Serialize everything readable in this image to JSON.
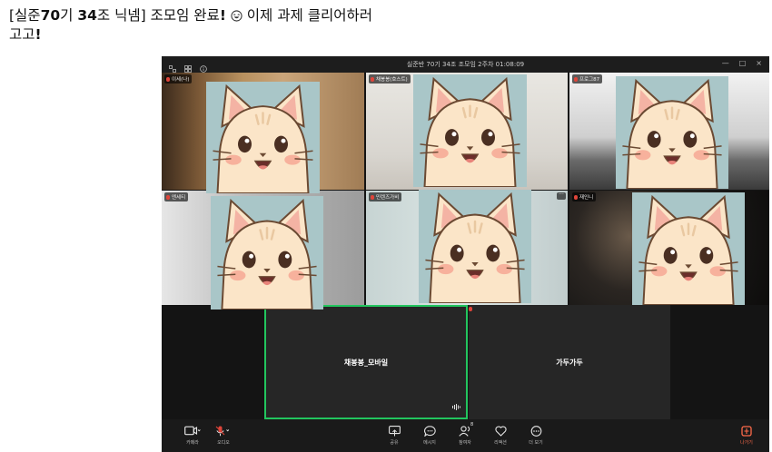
{
  "post": {
    "title_pre": "[실준",
    "title_num1": "70",
    "title_mid1": "기 ",
    "title_num2": "34",
    "title_mid2": "조 닉넴] 조모임 완료",
    "title_bang": "!",
    "title_after": "이제 과제 클리어하러",
    "title_line2": "고고",
    "title_bang2": "!"
  },
  "window": {
    "title": "실준반 70기 34조 조모임 2주차 01:08:09",
    "minimize": "—",
    "maximize": "□",
    "close": "×"
  },
  "participants": [
    {
      "name": "이세(나)"
    },
    {
      "name": "채봉봉(호스트)"
    },
    {
      "name": "프로그87"
    },
    {
      "name": "엔세티"
    },
    {
      "name": "민렌즈가비"
    },
    {
      "name": "재인니"
    }
  ],
  "bottom_tiles": [
    {
      "name": "채봉봉_모바일"
    },
    {
      "name": "가두가두"
    }
  ],
  "toolbar": {
    "camera": "카메라",
    "audio": "오디오",
    "share": "공유",
    "message": "메시지",
    "participants": "참여자",
    "participants_count": "8",
    "reaction": "리액션",
    "more": "더 보기",
    "leave": "나가기"
  },
  "colors": {
    "active_speaker": "#22c55e",
    "leave": "#ff6b4a",
    "muted": "#e0453a"
  }
}
